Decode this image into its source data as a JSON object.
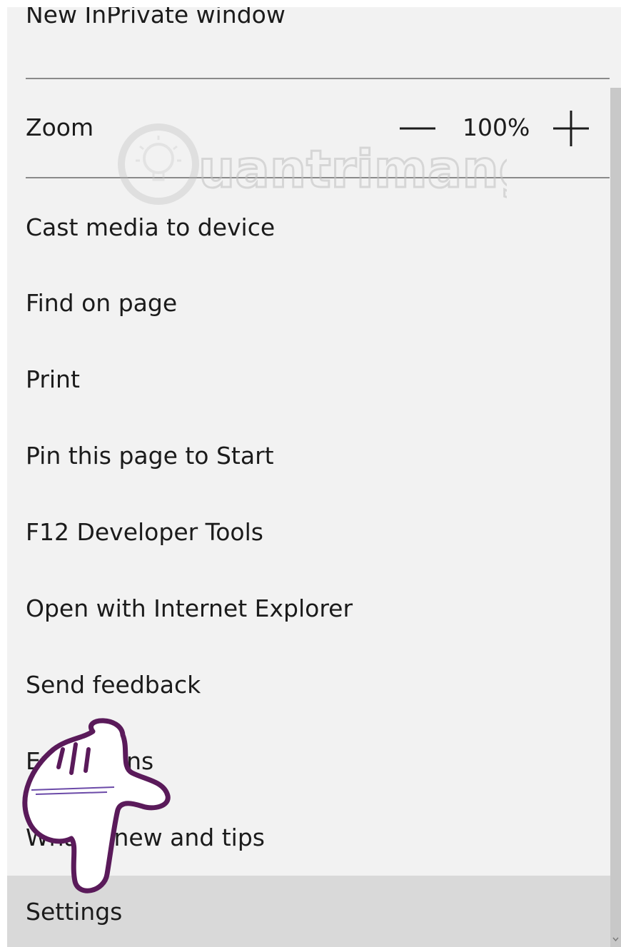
{
  "menu": {
    "new_inprivate": "New InPrivate window",
    "zoom": {
      "label": "Zoom",
      "value": "100%",
      "minus_icon": "minus-icon",
      "plus_icon": "plus-icon"
    },
    "items": [
      "Cast media to device",
      "Find on page",
      "Print",
      "Pin this page to Start",
      "F12 Developer Tools",
      "Open with Internet Explorer",
      "Send feedback",
      "Extensions",
      "What's new and tips",
      "Settings"
    ],
    "selected_item": "Settings"
  },
  "watermark": {
    "text": "uantrimang",
    "icon": "lightbulb-icon"
  },
  "colors": {
    "menu_background": "#f2f2f2",
    "selected_background": "#d9d9d9",
    "text": "#1b1b1b",
    "divider": "#8a8a8a",
    "scrollbar": "#c8c8c8",
    "hand_outline": "#5a1a5a"
  }
}
